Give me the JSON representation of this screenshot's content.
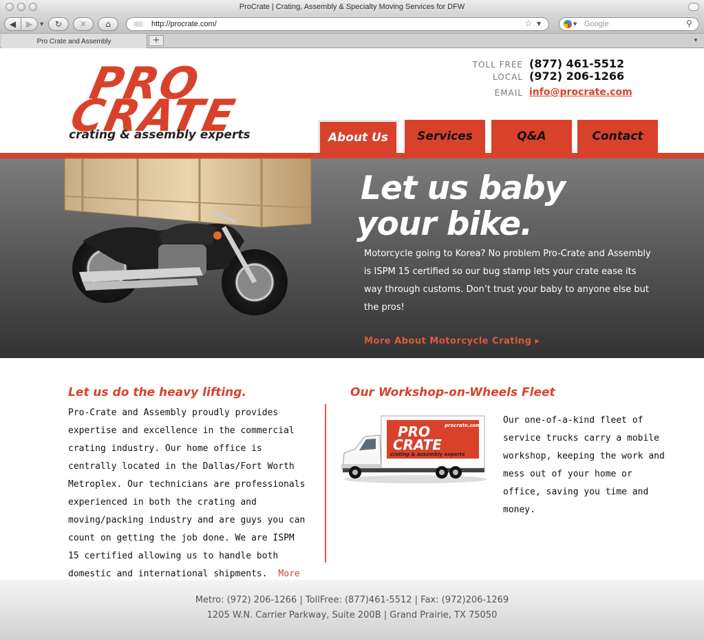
{
  "browser": {
    "window_title": "ProCrate | Crating, Assembly & Specialty Moving Services for DFW",
    "url": "http://procrate.com/",
    "search_placeholder": "Google",
    "tab_title": "Pro Crate and Assembly",
    "new_tab_label": "+",
    "tab_menu_label": "▾"
  },
  "logo": {
    "line1": "PRO",
    "line2": "CRATE",
    "tagline": "crating & assembly experts"
  },
  "contact": {
    "toll_free_label": "TOLL FREE",
    "toll_free": "(877) 461-5512",
    "local_label": "LOCAL",
    "local": "(972) 206-1266",
    "email_label": "EMAIL",
    "email": "info@procrate.com"
  },
  "nav": {
    "about": "About Us",
    "services": "Services",
    "qa": "Q&A",
    "contact": "Contact"
  },
  "hero": {
    "title_line1": "Let us baby",
    "title_line2": "your bike.",
    "body": "Motorcycle going to Korea?  No problem Pro-Crate and Assembly is ISPM 15 certified so our bug stamp lets your crate ease its way through customs. Don’t trust your baby to anyone else but the pros!",
    "link": "More About Motorcycle Crating ▸"
  },
  "left_section": {
    "title": "Let us do the heavy lifting.",
    "body": "Pro-Crate and Assembly proudly provides expertise and excellence in the commercial crating industry. Our home office is centrally located in the Dallas/Fort Worth Metroplex. Our technicians are professionals experienced in both the crating and moving/packing industry and are guys you can count on getting the job done. We are ISPM 15 certified allowing us to handle both domestic and international shipments.",
    "more": "More ▸"
  },
  "right_section": {
    "title": "Our Workshop-on-Wheels Fleet",
    "body": "Our one-of-a-kind fleet of service trucks carry a mobile workshop, keeping the work and mess out of your home or office, saving you time and money.",
    "truck_logo_line1": "PRO",
    "truck_logo_line2": "CRATE",
    "truck_logo_url": "procrate.com",
    "truck_logo_tagline": "crating & assembly experts"
  },
  "footer": {
    "line1": "Metro: (972) 206-1266   |   TollFree: (877)461-5512   |   Fax: (972)206-1269",
    "line2": "1205 W.N. Carrier Parkway, Suite 200B  |  Grand Prairie, TX 75050"
  },
  "colors": {
    "brand_red": "#d8422b",
    "hero_top": "#7c7c7c",
    "hero_bottom": "#323232"
  }
}
